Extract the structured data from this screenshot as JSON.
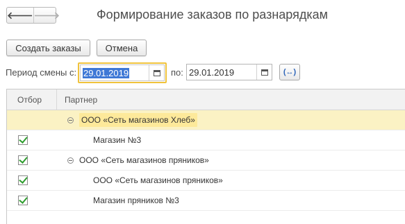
{
  "window": {
    "title": "Формирование заказов по разнарядкам"
  },
  "nav": {
    "back_icon": "arrow-left-icon",
    "forward_icon": "arrow-right-icon",
    "back_glyph": "🡐",
    "forward_glyph": "🡒"
  },
  "toolbar": {
    "create_label": "Создать заказы",
    "cancel_label": "Отмена"
  },
  "period": {
    "label": "Период смены с:",
    "from_value": "29.01.2019",
    "to_label": "по:",
    "to_value": "29.01.2019",
    "swap_glyph": "(↔)"
  },
  "table": {
    "columns": {
      "select": "Отбор",
      "partner": "Партнер"
    },
    "rows": [
      {
        "type": "group",
        "label": "ООО «Сеть магазинов Хлеб»",
        "checked": false,
        "active": true
      },
      {
        "type": "item",
        "label": "Магазин №3",
        "checked": true
      },
      {
        "type": "group",
        "label": "ООО «Сеть магазинов пряников»",
        "checked": true
      },
      {
        "type": "item",
        "label": "ООО «Сеть магазинов пряников»",
        "checked": true
      },
      {
        "type": "item",
        "label": "Магазин пряников №3",
        "checked": true
      }
    ]
  },
  "colors": {
    "active_row": "#fbf2c4",
    "focus_border": "#f0c33c",
    "selection": "#3e78d6",
    "check": "#2f9d2f"
  }
}
